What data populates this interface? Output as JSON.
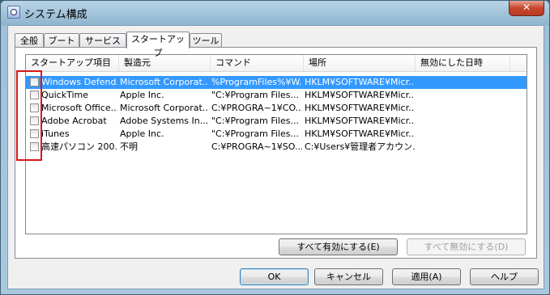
{
  "window": {
    "title": "システム構成",
    "close_label": "✕"
  },
  "tabs": [
    {
      "label": "全般"
    },
    {
      "label": "ブート"
    },
    {
      "label": "サービス"
    },
    {
      "label": "スタートアップ"
    },
    {
      "label": "ツール"
    }
  ],
  "list": {
    "columns": [
      "スタートアップ項目",
      "製造元",
      "コマンド",
      "場所",
      "無効にした日時"
    ],
    "rows": [
      {
        "name": "Windows Defend...",
        "maker": "Microsoft Corporat...",
        "command": "%ProgramFiles%¥W...",
        "location": "HKLM¥SOFTWARE¥Micr...",
        "disabled": ""
      },
      {
        "name": "QuickTime",
        "maker": "Apple Inc.",
        "command": "\"C:¥Program Files...",
        "location": "HKLM¥SOFTWARE¥Micr...",
        "disabled": ""
      },
      {
        "name": "Microsoft Office...",
        "maker": "Microsoft Corporat...",
        "command": "C:¥PROGRA~1¥CO...",
        "location": "HKLM¥SOFTWARE¥Micr...",
        "disabled": ""
      },
      {
        "name": "Adobe Acrobat",
        "maker": "Adobe Systems In...",
        "command": "\"C:¥Program Files...",
        "location": "HKLM¥SOFTWARE¥Micr...",
        "disabled": ""
      },
      {
        "name": "iTunes",
        "maker": "Apple Inc.",
        "command": "\"C:¥Program Files...",
        "location": "HKLM¥SOFTWARE¥Micr...",
        "disabled": ""
      },
      {
        "name": "高速パソコン 200...",
        "maker": "不明",
        "command": "C:¥PROGRA~1¥SO...",
        "location": "C:¥Users¥管理者アカウン...",
        "disabled": ""
      }
    ]
  },
  "panel_buttons": {
    "enable_all": "すべて有効にする(E)",
    "disable_all": "すべて無効にする(D)"
  },
  "dialog_buttons": {
    "ok": "OK",
    "cancel": "キャンセル",
    "apply": "適用(A)",
    "help": "ヘルプ"
  }
}
